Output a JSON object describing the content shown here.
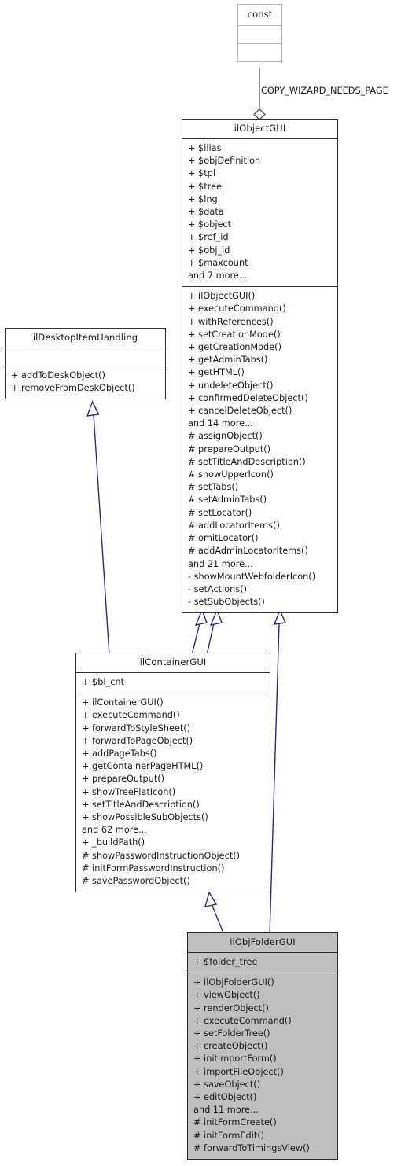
{
  "diagram": {
    "type": "uml-class-diagram",
    "edge_labels": [
      {
        "name": "copy-wizard-needs-page-label",
        "text": "COPY_WIZARD_NEEDS_PAGE"
      }
    ],
    "classes": [
      {
        "id": "const",
        "name": "const",
        "attributes": [],
        "operations": [],
        "highlight": false,
        "style": "light"
      },
      {
        "id": "ilObjectGUI",
        "name": "ilObjectGUI",
        "attributes": [
          "+ $ilias",
          "+ $objDefinition",
          "+ $tpl",
          "+ $tree",
          "+ $lng",
          "+ $data",
          "+ $object",
          "+ $ref_id",
          "+ $obj_id",
          "+ $maxcount",
          "and 7 more..."
        ],
        "operations": [
          "+ ilObjectGUI()",
          "+ executeCommand()",
          "+ withReferences()",
          "+ setCreationMode()",
          "+ getCreationMode()",
          "+ getAdminTabs()",
          "+ getHTML()",
          "+ undeleteObject()",
          "+ confirmedDeleteObject()",
          "+ cancelDeleteObject()",
          "and 14 more...",
          "# assignObject()",
          "# prepareOutput()",
          "# setTitleAndDescription()",
          "# showUpperIcon()",
          "# setTabs()",
          "# setAdminTabs()",
          "# setLocator()",
          "# addLocatorItems()",
          "# omitLocator()",
          "# addAdminLocatorItems()",
          "and 21 more...",
          "- showMountWebfolderIcon()",
          "- setActions()",
          "- setSubObjects()"
        ],
        "highlight": false,
        "style": "normal"
      },
      {
        "id": "ilDesktopItemHandling",
        "name": "ilDesktopItemHandling",
        "attributes": [],
        "operations": [
          "+ addToDeskObject()",
          "+ removeFromDeskObject()"
        ],
        "highlight": false,
        "style": "normal"
      },
      {
        "id": "ilContainerGUI",
        "name": "ilContainerGUI",
        "attributes": [
          "+ $bl_cnt"
        ],
        "operations": [
          "+ ilContainerGUI()",
          "+ executeCommand()",
          "+ forwardToStyleSheet()",
          "+ forwardToPageObject()",
          "+ addPageTabs()",
          "+ getContainerPageHTML()",
          "+ prepareOutput()",
          "+ showTreeFlatIcon()",
          "+ setTitleAndDescription()",
          "+ showPossibleSubObjects()",
          "and 62 more...",
          "+ _buildPath()",
          "# showPasswordInstructionObject()",
          "# initFormPasswordInstruction()",
          "# savePasswordObject()"
        ],
        "highlight": false,
        "style": "normal"
      },
      {
        "id": "ilObjFolderGUI",
        "name": "ilObjFolderGUI",
        "attributes": [
          "+ $folder_tree"
        ],
        "operations": [
          "+ ilObjFolderGUI()",
          "+ viewObject()",
          "+ renderObject()",
          "+ executeCommand()",
          "+ setFolderTree()",
          "+ createObject()",
          "+ initImportForm()",
          "+ importFileObject()",
          "+ saveObject()",
          "+ editObject()",
          "and 11 more...",
          "# initFormCreate()",
          "# initFormEdit()",
          "# forwardToTimingsView()"
        ],
        "highlight": true,
        "style": "normal"
      }
    ],
    "colors": {
      "edge_inheritance": "#2a2a7a",
      "edge_association": "#4a4a4a",
      "box_border": "#2b2b2b",
      "box_border_light": "#b5b5b5",
      "highlight_fill": "#bfbfbf",
      "background": "#ffffff"
    }
  }
}
